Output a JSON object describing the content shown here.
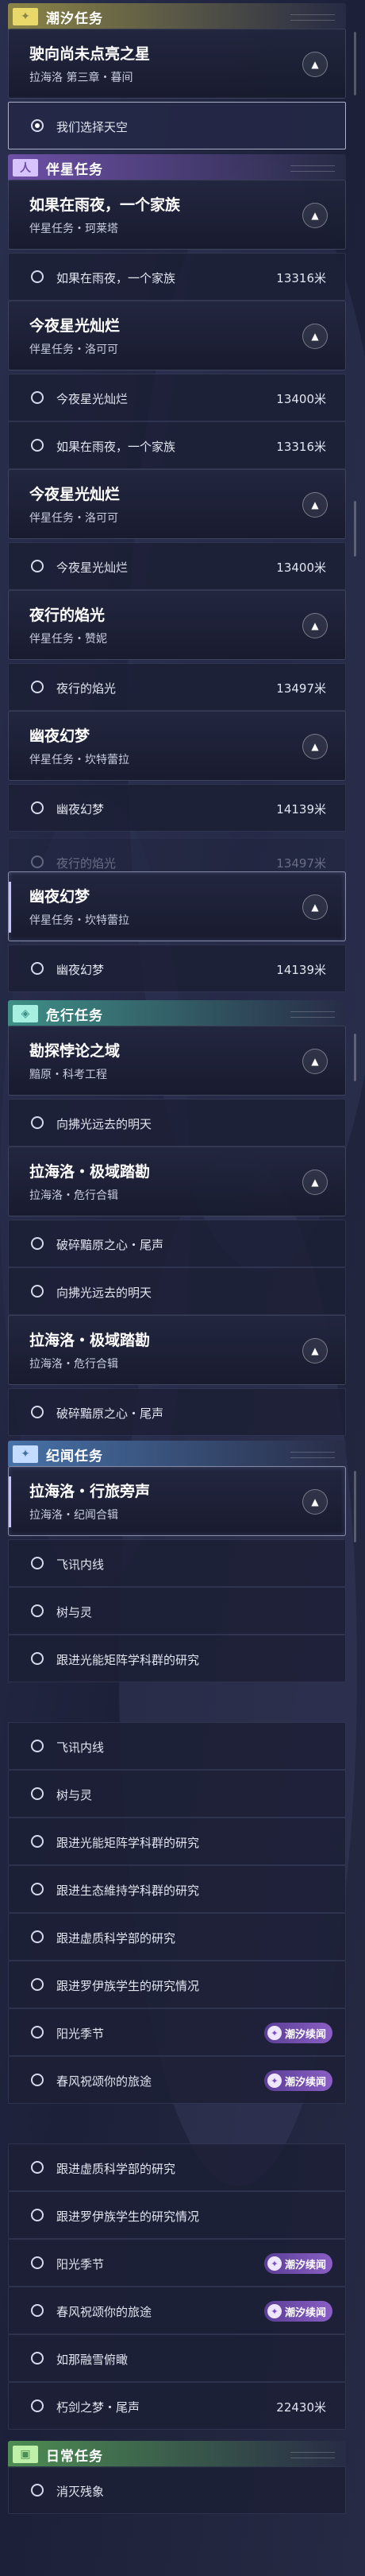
{
  "sections": [
    {
      "id": "tide",
      "title": "潮汐任务",
      "icon": "✦",
      "head_color": "#8b8446",
      "icon_bg": "#e9d86a"
    },
    {
      "id": "companion",
      "title": "伴星任务",
      "icon": "人",
      "head_color": "#6d4fa6",
      "icon_bg": "#d7c4ff"
    },
    {
      "id": "danger",
      "title": "危行任务",
      "icon": "◈",
      "head_color": "#3e8f86",
      "icon_bg": "#a6efe1"
    },
    {
      "id": "chronicle",
      "title": "纪闻任务",
      "icon": "✦",
      "head_color": "#4772a8",
      "icon_bg": "#c4dcff"
    },
    {
      "id": "daily",
      "title": "日常任务",
      "icon": "▣",
      "head_color": "#4d8d52",
      "icon_bg": "#bff0a9"
    }
  ],
  "cards": [
    {
      "title": "驶向尚未点亮之星",
      "subtitle": "拉海洛 第三章・暮间",
      "expanded": true,
      "selected": false
    },
    {
      "title": "如果在雨夜，一个家族",
      "subtitle": "伴星任务・珂莱塔",
      "expanded": true,
      "selected": false
    },
    {
      "title": "今夜星光灿烂",
      "subtitle": "伴星任务・洛可可",
      "expanded": true,
      "selected": false
    },
    {
      "title": "今夜星光灿烂",
      "subtitle": "伴星任务・洛可可",
      "expanded": true,
      "selected": false
    },
    {
      "title": "夜行的焰光",
      "subtitle": "伴星任务・赞妮",
      "expanded": true,
      "selected": false
    },
    {
      "title": "幽夜幻梦",
      "subtitle": "伴星任务・坎特蕾拉",
      "expanded": true,
      "selected": false
    },
    {
      "title": "幽夜幻梦",
      "subtitle": "伴星任务・坎特蕾拉",
      "expanded": true,
      "selected": true
    },
    {
      "title": "勘探悖论之域",
      "subtitle": "黯原・科考工程",
      "expanded": true,
      "selected": false
    },
    {
      "title": "拉海洛・极域踏勘",
      "subtitle": "拉海洛・危行合辑",
      "expanded": true,
      "selected": false
    },
    {
      "title": "拉海洛・极域踏勘",
      "subtitle": "拉海洛・危行合辑",
      "expanded": true,
      "selected": false
    },
    {
      "title": "拉海洛・行旅旁声",
      "subtitle": "拉海洛・纪闻合辑",
      "expanded": true,
      "selected": true
    }
  ],
  "rows": [
    {
      "label": "我们选择天空",
      "dist": "",
      "tag": "",
      "active": true
    },
    {
      "label": "如果在雨夜，一个家族",
      "dist": "13316米",
      "tag": "",
      "active": false
    },
    {
      "label": "今夜星光灿烂",
      "dist": "13400米",
      "tag": "",
      "active": false
    },
    {
      "label": "如果在雨夜，一个家族",
      "dist": "13316米",
      "tag": "",
      "active": false
    },
    {
      "label": "今夜星光灿烂",
      "dist": "13400米",
      "tag": "",
      "active": false
    },
    {
      "label": "夜行的焰光",
      "dist": "13497米",
      "tag": "",
      "active": false
    },
    {
      "label": "幽夜幻梦",
      "dist": "14139米",
      "tag": "",
      "active": false
    },
    {
      "label": "夜行的焰光",
      "dist": "13497米",
      "tag": "",
      "active": false
    },
    {
      "label": "幽夜幻梦",
      "dist": "14139米",
      "tag": "",
      "active": false
    },
    {
      "label": "向拂光远去的明天",
      "dist": "",
      "tag": "",
      "active": false
    },
    {
      "label": "破碎黯原之心・尾声",
      "dist": "",
      "tag": "",
      "active": false
    },
    {
      "label": "向拂光远去的明天",
      "dist": "",
      "tag": "",
      "active": false
    },
    {
      "label": "破碎黯原之心・尾声",
      "dist": "",
      "tag": "",
      "active": false
    },
    {
      "label": "飞讯内线",
      "dist": "",
      "tag": "",
      "active": false
    },
    {
      "label": "树与灵",
      "dist": "",
      "tag": "",
      "active": false
    },
    {
      "label": "跟进光能矩阵学科群的研究",
      "dist": "",
      "tag": "",
      "active": false
    },
    {
      "label": "飞讯内线",
      "dist": "",
      "tag": "",
      "active": false
    },
    {
      "label": "树与灵",
      "dist": "",
      "tag": "",
      "active": false
    },
    {
      "label": "跟进光能矩阵学科群的研究",
      "dist": "",
      "tag": "",
      "active": false
    },
    {
      "label": "跟进生态維持学科群的研究",
      "dist": "",
      "tag": "",
      "active": false
    },
    {
      "label": "跟进虚质科学部的研究",
      "dist": "",
      "tag": "",
      "active": false
    },
    {
      "label": "跟进罗伊族学生的研究情况",
      "dist": "",
      "tag": "",
      "active": false
    },
    {
      "label": "阳光季节",
      "dist": "",
      "tag": "潮汐续闻",
      "active": false
    },
    {
      "label": "春风祝颂你的旅途",
      "dist": "",
      "tag": "潮汐续闻",
      "active": false
    },
    {
      "label": "跟进虚质科学部的研究",
      "dist": "",
      "tag": "",
      "active": false
    },
    {
      "label": "跟进罗伊族学生的研究情况",
      "dist": "",
      "tag": "",
      "active": false
    },
    {
      "label": "阳光季节",
      "dist": "",
      "tag": "潮汐续闻",
      "active": false
    },
    {
      "label": "春风祝颂你的旅途",
      "dist": "",
      "tag": "潮汐续闻",
      "active": false
    },
    {
      "label": "如那融雪俯瞰",
      "dist": "",
      "tag": "",
      "active": false
    },
    {
      "label": "朽剑之梦・尾声",
      "dist": "22430米",
      "tag": "",
      "active": false
    },
    {
      "label": "消灭残象",
      "dist": "",
      "tag": "",
      "active": false
    }
  ]
}
